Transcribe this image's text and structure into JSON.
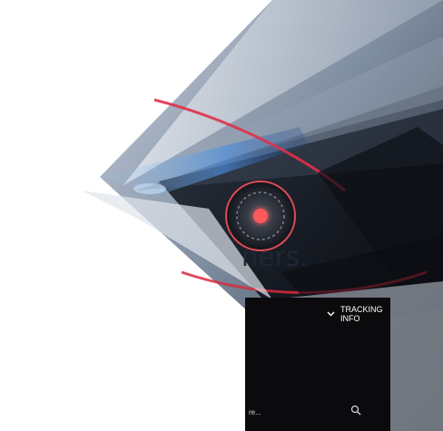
{
  "headline": {
    "text": "ners."
  },
  "widget": {
    "menu_label": "TRACKING INFO",
    "search_placeholder": "re..."
  },
  "icons": {
    "dropdown": "chevron-down-icon",
    "search": "search-icon"
  },
  "colors": {
    "widget_background": "#0b0b0d",
    "accent_red": "#e2304a",
    "headline_text": "#1f2733"
  }
}
